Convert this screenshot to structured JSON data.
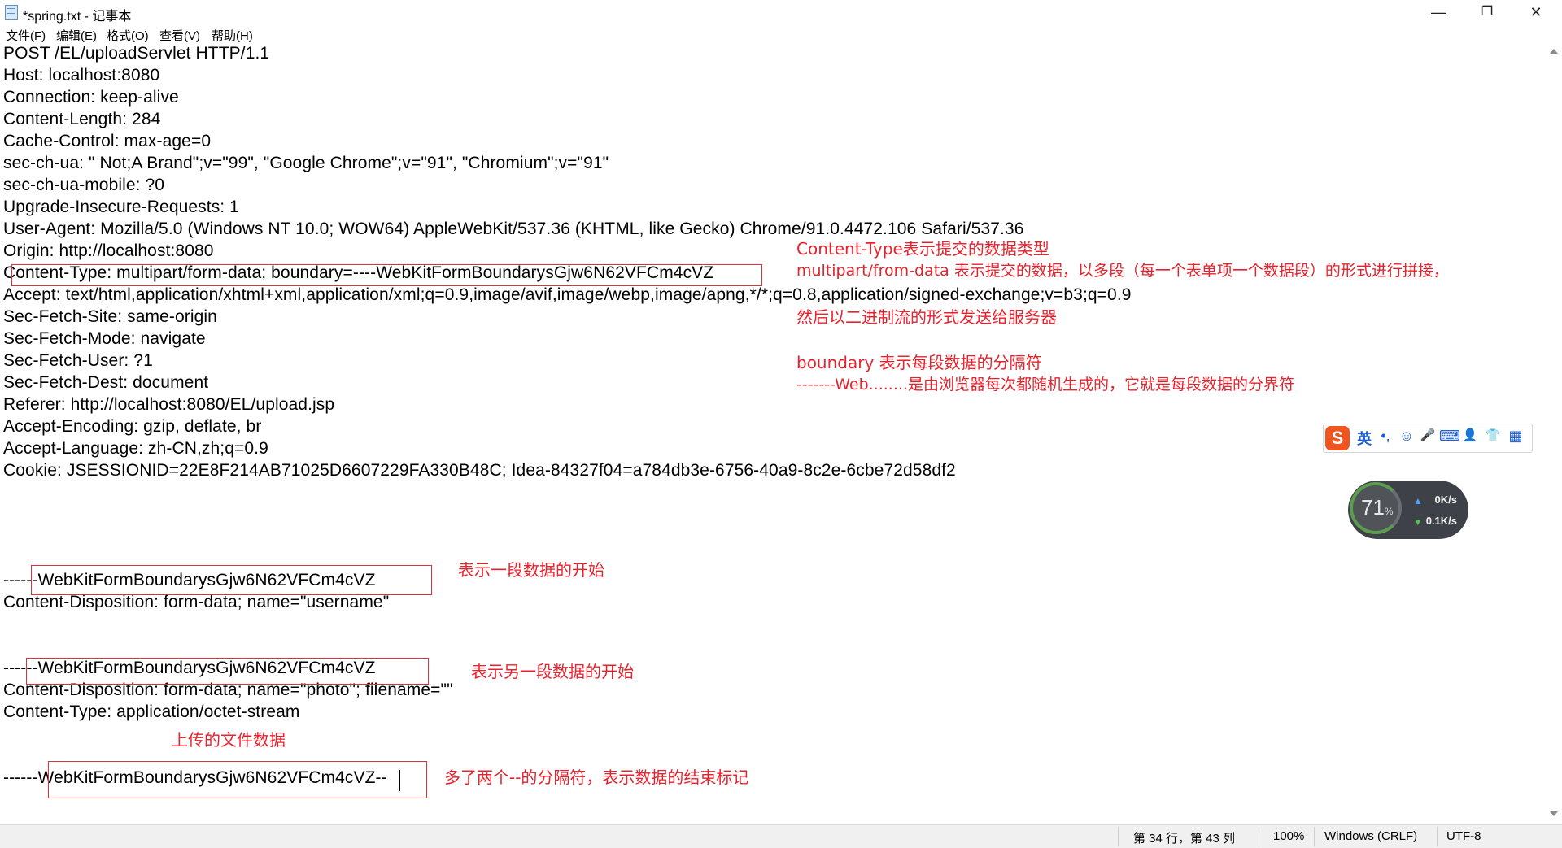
{
  "window": {
    "title": "*spring.txt - 记事本",
    "minimize": "—",
    "maximize": "❐",
    "close": "✕"
  },
  "menu": [
    "文件(F)",
    "编辑(E)",
    "格式(O)",
    "查看(V)",
    "帮助(H)"
  ],
  "editor": {
    "lines": [
      "POST /EL/uploadServlet HTTP/1.1",
      "Host: localhost:8080",
      "Connection: keep-alive",
      "Content-Length: 284",
      "Cache-Control: max-age=0",
      "sec-ch-ua: \" Not;A Brand\";v=\"99\", \"Google Chrome\";v=\"91\", \"Chromium\";v=\"91\"",
      "sec-ch-ua-mobile: ?0",
      "Upgrade-Insecure-Requests: 1",
      "User-Agent: Mozilla/5.0 (Windows NT 10.0; WOW64) AppleWebKit/537.36 (KHTML, like Gecko) Chrome/91.0.4472.106 Safari/537.36",
      "Origin: http://localhost:8080",
      "Content-Type: multipart/form-data; boundary=----WebKitFormBoundarysGjw6N62VFCm4cVZ",
      "Accept: text/html,application/xhtml+xml,application/xml;q=0.9,image/avif,image/webp,image/apng,*/*;q=0.8,application/signed-exchange;v=b3;q=0.9",
      "Sec-Fetch-Site: same-origin",
      "Sec-Fetch-Mode: navigate",
      "Sec-Fetch-User: ?1",
      "Sec-Fetch-Dest: document",
      "Referer: http://localhost:8080/EL/upload.jsp",
      "Accept-Encoding: gzip, deflate, br",
      "Accept-Language: zh-CN,zh;q=0.9",
      "Cookie: JSESSIONID=22E8F214AB71025D6607229FA330B48C; Idea-84327f04=a784db3e-6756-40a9-8c2e-6cbe72d58df2",
      "",
      "",
      "",
      "------WebKitFormBoundarysGjw6N62VFCm4cVZ",
      "Content-Disposition: form-data; name=\"username\"",
      "",
      "",
      "------WebKitFormBoundarysGjw6N62VFCm4cVZ",
      "Content-Disposition: form-data; name=\"photo\"; filename=\"\"",
      "Content-Type: application/octet-stream",
      "",
      "",
      "------WebKitFormBoundarysGjw6N62VFCm4cVZ--"
    ]
  },
  "annotations": {
    "content_type_title": "Content-Type表示提交的数据类型",
    "multipart_desc": "multipart/from-data 表示提交的数据，以多段（每一个表单项一个数据段）的形式进行拼接，",
    "binary_desc": "然后以二进制流的形式发送给服务器",
    "boundary_title": "boundary 表示每段数据的分隔符",
    "boundary_desc": "-------Web........是由浏览器每次都随机生成的，它就是每段数据的分界符",
    "segment_start": "表示一段数据的开始",
    "segment_start2": "表示另一段数据的开始",
    "uploaded_data": "上传的文件数据",
    "end_marker": "多了两个--的分隔符，表示数据的结束标记"
  },
  "status": {
    "position": "第 34 行，第 43 列",
    "zoom": "100%",
    "line_ending": "Windows (CRLF)",
    "encoding": "UTF-8"
  },
  "ime": {
    "logo": "S",
    "mode": "英",
    "punct": "•,",
    "emoji": "☺",
    "mic": "🎤",
    "keyboard": "⌨",
    "user": "👤",
    "skin": "👕",
    "apps": "▦"
  },
  "speed_widget": {
    "percent": "71",
    "percent_unit": "%",
    "upload": "0K/s",
    "download": "0.1K/s"
  }
}
